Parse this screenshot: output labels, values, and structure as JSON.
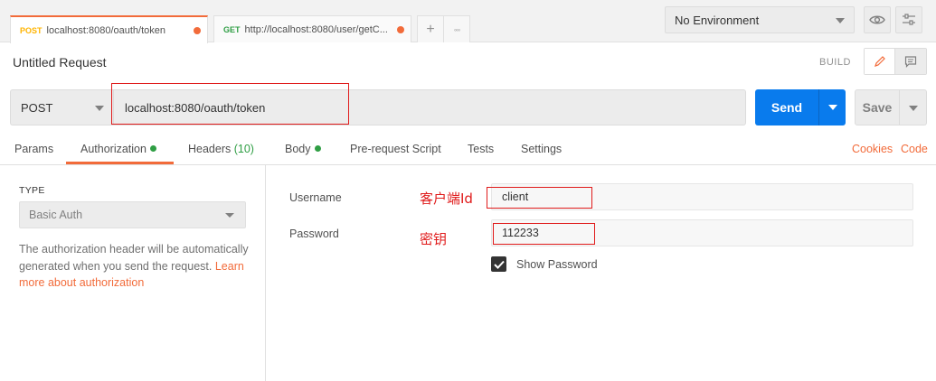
{
  "tabs": [
    {
      "method": "POST",
      "url": "localhost:8080/oauth/token"
    },
    {
      "method": "GET",
      "url": "http://localhost:8080/user/getC..."
    }
  ],
  "tab_add": "+",
  "tab_more": "◦◦◦",
  "environment": {
    "selected": "No Environment"
  },
  "request": {
    "title": "Untitled Request",
    "build_label": "BUILD",
    "method": "POST",
    "url": "localhost:8080/oauth/token",
    "send_label": "Send",
    "save_label": "Save"
  },
  "subtabs": {
    "params": "Params",
    "authorization": "Authorization",
    "headers": "Headers",
    "headers_count": "(10)",
    "body": "Body",
    "prerequest": "Pre-request Script",
    "tests": "Tests",
    "settings": "Settings",
    "cookies": "Cookies",
    "code": "Code"
  },
  "auth": {
    "type_label": "TYPE",
    "type_value": "Basic Auth",
    "description": "The authorization header will be automatically generated when you send the request.",
    "learn_more": "Learn more about authorization",
    "username_label": "Username",
    "username_value": "client",
    "username_annotation": "客户端Id",
    "password_label": "Password",
    "password_value": "112233",
    "password_annotation": "密钥",
    "show_password_label": "Show Password"
  },
  "colors": {
    "accent": "#f26b3a",
    "send": "#097bed",
    "annotation": "#e01b1b",
    "ok": "#2f9e44"
  }
}
